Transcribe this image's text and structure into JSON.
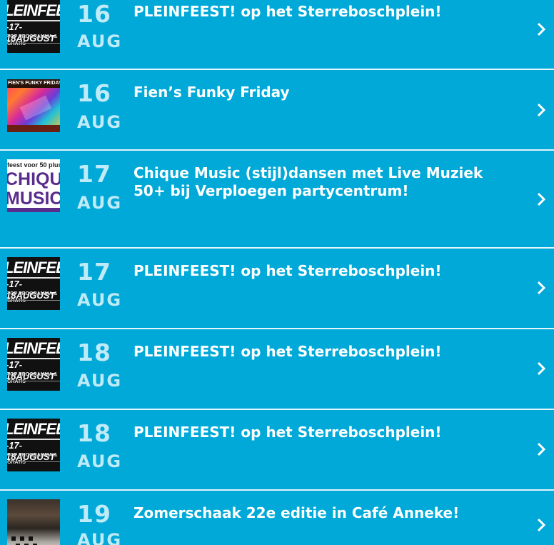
{
  "events": [
    {
      "day": "16",
      "month": "AUG",
      "title": "PLEINFEEST! op het Sterreboschplein!",
      "thumb": {
        "kind": "pleinfeest",
        "line1": "LEINFEES",
        "line2": "-17-18AUGUST",
        "line3": "TOP PROGRAMMA & GRATIS"
      }
    },
    {
      "day": "16",
      "month": "AUG",
      "title": "Fien’s Funky Friday",
      "thumb": {
        "kind": "funky",
        "line1": "FIEN'S FUNKY FRIDAY"
      }
    },
    {
      "day": "17",
      "month": "AUG",
      "title": "Chique Music (stijl)dansen met Live Muziek 50+ bij Verploegen partycentrum!",
      "thumb": {
        "kind": "chique",
        "line1": "feest voor 50 plus",
        "line2": "CHIQUE",
        "line3": "MUSIC"
      }
    },
    {
      "day": "17",
      "month": "AUG",
      "title": "PLEINFEEST! op het Sterreboschplein!",
      "thumb": {
        "kind": "pleinfeest",
        "line1": "LEINFEES",
        "line2": "-17-18AUGUST",
        "line3": "TOP PROGRAMMA & GRATIS"
      }
    },
    {
      "day": "18",
      "month": "AUG",
      "title": "PLEINFEEST! op het Sterreboschplein!",
      "thumb": {
        "kind": "pleinfeest",
        "line1": "LEINFEES",
        "line2": "-17-18AUGUST",
        "line3": "TOP PROGRAMMA & GRATIS"
      }
    },
    {
      "day": "18",
      "month": "AUG",
      "title": "PLEINFEEST! op het Sterreboschplein!",
      "thumb": {
        "kind": "pleinfeest",
        "line1": "LEINFEES",
        "line2": "-17-18AUGUST",
        "line3": "TOP PROGRAMMA & GRATIS"
      }
    },
    {
      "day": "19",
      "month": "AUG",
      "title": "Zomerschaak 22e editie in Café Anneke!",
      "thumb": {
        "kind": "cafe"
      }
    }
  ],
  "colors": {
    "background": "#00a9d8",
    "divider": "#e4f5fb",
    "date_text": "#bfeaf7",
    "title_text": "#ffffff"
  },
  "icons": {
    "row_arrow": "chevron-right-icon"
  }
}
